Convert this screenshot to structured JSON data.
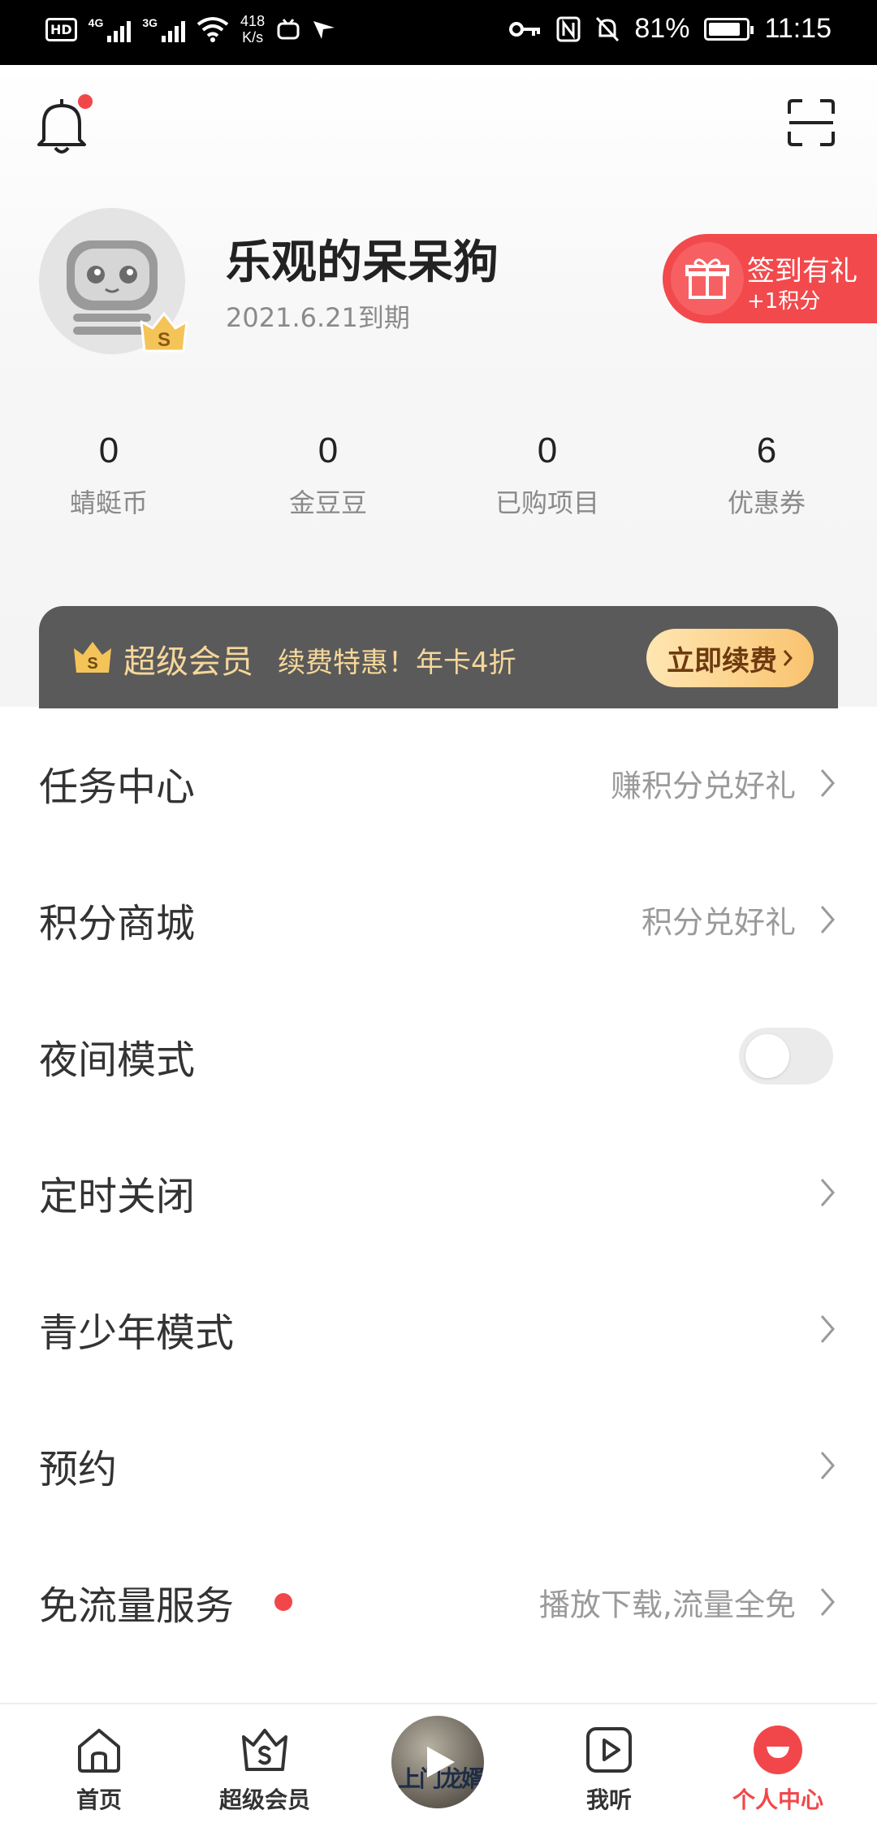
{
  "status_bar": {
    "network_speed_value": "418",
    "network_speed_unit": "K/s",
    "signal_1_label": "4G",
    "signal_2_label": "3G",
    "battery": "81%",
    "time": "11:15"
  },
  "header": {
    "has_notification": true
  },
  "profile": {
    "username": "乐观的呆呆狗",
    "expiry": "2021.6.21到期",
    "vip_badge_letter": "S"
  },
  "signin": {
    "title": "签到有礼",
    "subtitle": "+1积分"
  },
  "stats": [
    {
      "value": "0",
      "label": "蜻蜓币"
    },
    {
      "value": "0",
      "label": "金豆豆"
    },
    {
      "value": "0",
      "label": "已购项目"
    },
    {
      "value": "6",
      "label": "优惠券"
    }
  ],
  "vip_banner": {
    "name": "超级会员",
    "promo": "续费特惠！年卡4折",
    "button": "立即续费"
  },
  "menu": [
    {
      "label": "任务中心",
      "hint": "赚积分兑好礼"
    },
    {
      "label": "积分商城",
      "hint": "积分兑好礼"
    },
    {
      "label": "夜间模式",
      "toggle_on": false
    },
    {
      "label": "定时关闭"
    },
    {
      "label": "青少年模式"
    },
    {
      "label": "预约"
    },
    {
      "label": "免流量服务",
      "hint": "播放下载,流量全免",
      "badge": true
    }
  ],
  "tabbar": {
    "tabs": [
      {
        "label": "首页",
        "active": false
      },
      {
        "label": "超级会员",
        "active": false
      },
      {
        "label": "我听",
        "active": false
      },
      {
        "label": "个人中心",
        "active": true
      }
    ],
    "player_cover_text": "上门龙婿"
  },
  "colors": {
    "accent": "#f2474a",
    "vip_gold": "#f6d79a",
    "vip_bar_bg": "#5a5a5a"
  }
}
